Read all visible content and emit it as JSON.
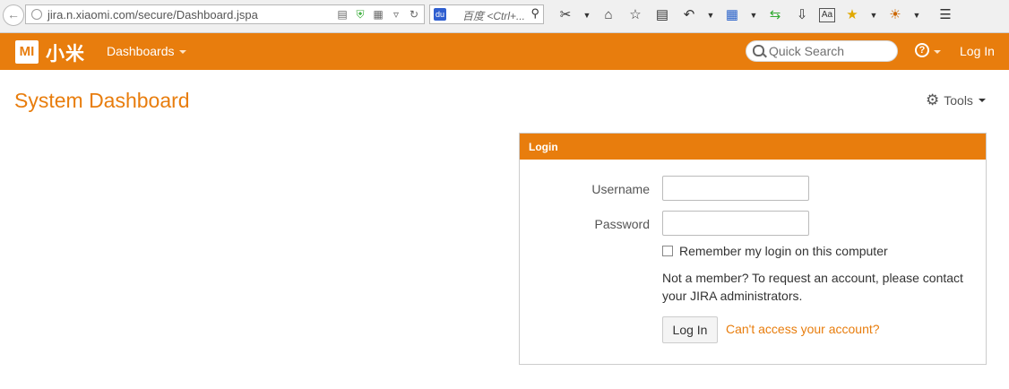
{
  "browser": {
    "url": "jira.n.xiaomi.com/secure/Dashboard.jspa",
    "search_placeholder": "百度 <Ctrl+..."
  },
  "header": {
    "logo_mark": "MI",
    "logo_text": "小米",
    "nav_dashboards": "Dashboards",
    "quick_search_placeholder": "Quick Search",
    "help_symbol": "?",
    "login_link": "Log In"
  },
  "page": {
    "title": "System Dashboard",
    "tools_label": "Tools"
  },
  "login_gadget": {
    "title": "Login",
    "username_label": "Username",
    "password_label": "Password",
    "username_value": "",
    "password_value": "",
    "remember_label": "Remember my login on this computer",
    "remember_checked": false,
    "not_member_text": "Not a member? To request an account, please contact your JIRA administrators.",
    "login_button": "Log In",
    "cant_access_link": "Can't access your account?"
  },
  "colors": {
    "brand_orange": "#e87d0d",
    "text_gray": "#555555"
  }
}
